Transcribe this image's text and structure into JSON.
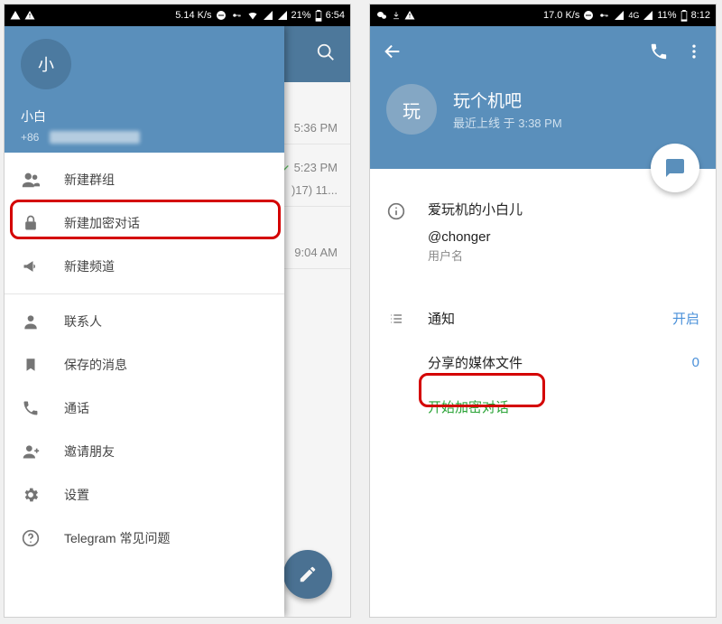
{
  "left": {
    "statusbar": {
      "speed": "5.14 K/s",
      "battery": "21%",
      "time": "6:54"
    },
    "behind": {
      "rows": [
        {
          "time": "5:36 PM",
          "snippet": ""
        },
        {
          "time": "5:23 PM",
          "snippet": ")17) 11..."
        },
        {
          "time": "9:04 AM",
          "snippet": ""
        }
      ]
    },
    "drawer": {
      "avatar_letter": "小",
      "username": "小白",
      "phone_prefix": "+86",
      "items_top": [
        {
          "icon": "group-icon",
          "label": "新建群组"
        },
        {
          "icon": "lock-icon",
          "label": "新建加密对话"
        },
        {
          "icon": "megaphone-icon",
          "label": "新建频道"
        }
      ],
      "items_bottom": [
        {
          "icon": "contact-icon",
          "label": "联系人"
        },
        {
          "icon": "bookmark-icon",
          "label": "保存的消息"
        },
        {
          "icon": "phone-icon",
          "label": "通话"
        },
        {
          "icon": "person-add-icon",
          "label": "邀请朋友"
        },
        {
          "icon": "gear-icon",
          "label": "设置"
        },
        {
          "icon": "help-icon",
          "label": "Telegram 常见问题"
        }
      ]
    }
  },
  "right": {
    "statusbar": {
      "speed": "17.0 K/s",
      "net": "4G",
      "battery": "11%",
      "time": "8:12"
    },
    "profile": {
      "avatar_letter": "玩",
      "name": "玩个机吧",
      "status_prefix": "最近上线 于 ",
      "status_time": "3:38 PM",
      "info_line1": "爱玩机的小白儿",
      "info_line2": "@chonger",
      "info_sub": "用户名",
      "notifications_label": "通知",
      "notifications_value": "开启",
      "shared_label": "分享的媒体文件",
      "shared_value": "0",
      "secret_chat_label": "开始加密对话"
    }
  }
}
